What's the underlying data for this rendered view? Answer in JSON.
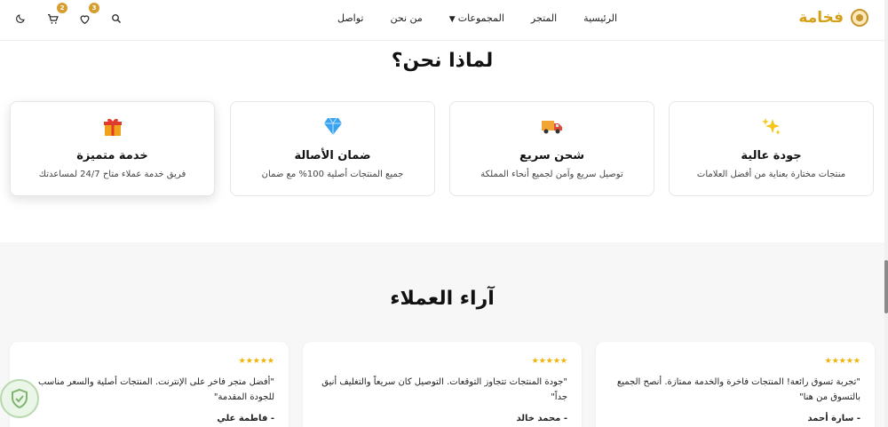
{
  "brand": {
    "name": "فخامة",
    "logo_icon": "crest-icon",
    "color": "#d4a017"
  },
  "nav": {
    "home": "الرئيسية",
    "store": "المتجر",
    "collections": "المجموعات",
    "about": "من نحن",
    "contact": "تواصل"
  },
  "header_icons": {
    "search": "search-icon",
    "wishlist": {
      "icon": "heart-icon",
      "count": "3"
    },
    "cart": {
      "icon": "cart-icon",
      "count": "2"
    },
    "theme": "moon-icon",
    "badge_color": "#d69e2e"
  },
  "why": {
    "title": "لماذا نحن؟",
    "features": [
      {
        "icon": "sparkles-icon",
        "title": "جودة عالية",
        "desc": "منتجات مختارة بعناية من أفضل العلامات"
      },
      {
        "icon": "truck-icon",
        "title": "شحن سريع",
        "desc": "توصيل سريع وآمن لجميع أنحاء المملكة"
      },
      {
        "icon": "diamond-icon",
        "title": "ضمان الأصالة",
        "desc": "جميع المنتجات أصلية 100% مع ضمان"
      },
      {
        "icon": "gift-icon",
        "title": "خدمة متميزة",
        "desc": "فريق خدمة عملاء متاح 24/7 لمساعدتك"
      }
    ]
  },
  "reviews": {
    "title": "آراء العملاء",
    "items": [
      {
        "stars": "★★★★★",
        "rating": 5,
        "text": "\"تجربة تسوق رائعة! المنتجات فاخرة والخدمة ممتازة. أنصح الجميع بالتسوق من هنا\"",
        "author": "- سارة أحمد"
      },
      {
        "stars": "★★★★★",
        "rating": 5,
        "text": "\"جودة المنتجات تتجاوز التوقعات. التوصيل كان سريعاً والتغليف أنيق جداً\"",
        "author": "- محمد خالد"
      },
      {
        "stars": "★★★★★",
        "rating": 5,
        "text": "\"أفضل متجر فاخر على الإنترنت. المنتجات أصلية والسعر مناسب للجودة المقدمة\"",
        "author": "- فاطمة علي"
      }
    ]
  },
  "watermark_icon": "shield-leaf-icon"
}
